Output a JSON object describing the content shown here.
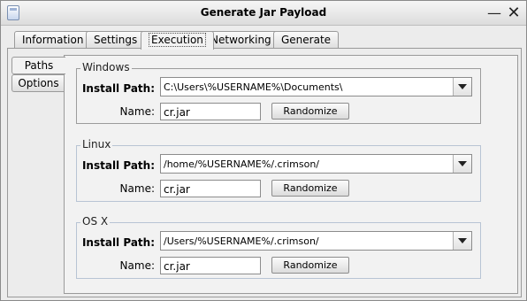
{
  "window": {
    "title": "Generate Jar Payload",
    "minimize_label": "—",
    "close_label": "✕"
  },
  "tabs": [
    {
      "label": "Information"
    },
    {
      "label": "Settings"
    },
    {
      "label": "Execution"
    },
    {
      "label": "Networking"
    },
    {
      "label": "Generate"
    }
  ],
  "active_tab": "Execution",
  "side_tabs": [
    {
      "label": "Paths"
    },
    {
      "label": "Options"
    }
  ],
  "active_side_tab": "Paths",
  "groups": {
    "windows": {
      "legend": "Windows",
      "install_label": "Install Path:",
      "install_value": "C:\\Users\\%USERNAME%\\Documents\\",
      "name_label": "Name:",
      "name_value": "cr.jar",
      "randomize_label": "Randomize"
    },
    "linux": {
      "legend": "Linux",
      "install_label": "Install Path:",
      "install_value": "/home/%USERNAME%/.crimson/",
      "name_label": "Name:",
      "name_value": "cr.jar",
      "randomize_label": "Randomize"
    },
    "osx": {
      "legend": "OS X",
      "install_label": "Install Path:",
      "install_value": "/Users/%USERNAME%/.crimson/",
      "name_label": "Name:",
      "name_value": "cr.jar",
      "randomize_label": "Randomize"
    }
  },
  "icons": {
    "app": "app-icon",
    "dropdown": "chevron-down-icon"
  }
}
